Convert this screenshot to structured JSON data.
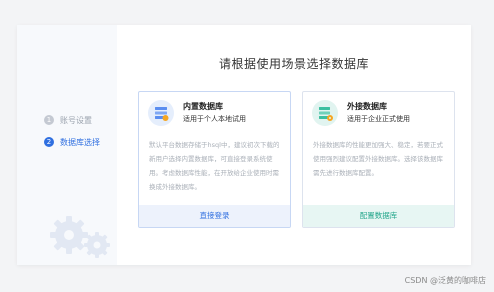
{
  "page_title": "请根据使用场景选择数据库",
  "steps": [
    {
      "num": "1",
      "label": "账号设置"
    },
    {
      "num": "2",
      "label": "数据库选择"
    }
  ],
  "options": {
    "builtin": {
      "name": "内置数据库",
      "subtitle": "适用于个人本地试用",
      "description": "默认平台数据存储于hsql中，建议初次下载的新用户选择内置数据库，可直接登录系统使用。考虑数据库性能，在开放给企业使用时需换成外接数据库。",
      "action": "直接登录",
      "accent": "#2f6fe0",
      "icon": "database-server-icon"
    },
    "external": {
      "name": "外接数据库",
      "subtitle": "适用于企业正式使用",
      "description": "外接数据库的性能更加强大、稳定，若要正式使用强烈建议配置外接数据库。选择该数据库需先进行数据库配置。",
      "action": "配置数据库",
      "accent": "#21a58a",
      "icon": "database-settings-icon"
    }
  },
  "watermark": "CSDN @泛黄的咖啡店"
}
